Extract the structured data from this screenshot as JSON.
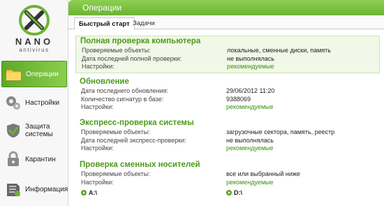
{
  "brand": {
    "name": "NANO",
    "sub": "antivirus"
  },
  "sidebar": {
    "items": [
      {
        "label": "Операции",
        "icon": "folder-scan-icon",
        "active": true
      },
      {
        "label": "Настройки",
        "icon": "gears-icon",
        "active": false
      },
      {
        "label": "Защита системы",
        "icon": "shield-check-icon",
        "active": false
      },
      {
        "label": "Карантин",
        "icon": "lock-icon",
        "active": false
      },
      {
        "label": "Информация",
        "icon": "info-book-icon",
        "active": false
      }
    ]
  },
  "header": {
    "title": "Операции"
  },
  "tabs": [
    {
      "label": "Быстрый старт",
      "active": true
    },
    {
      "label": "Задачи",
      "active": false
    }
  ],
  "sections": [
    {
      "title": "Полная проверка компьютера",
      "rows": [
        {
          "key": "Проверяемые объекты:",
          "value": "локальные, сменные диски, память"
        },
        {
          "key": "Дата последней полной проверки:",
          "value": "не выполнялась"
        },
        {
          "key": "Настройки:",
          "value": "рекомендуемые",
          "link": true
        }
      ]
    },
    {
      "title": "Обновление",
      "rows": [
        {
          "key": "Дата последнего обновления:",
          "value": "29/06/2012 11:20"
        },
        {
          "key": "Количество сигнатур в базе:",
          "value": "9388069"
        },
        {
          "key": "Настройки:",
          "value": "рекомендуемые",
          "link": true
        }
      ]
    },
    {
      "title": "Экспресс-проверка системы",
      "rows": [
        {
          "key": "Проверяемые объекты:",
          "value": "загрузочные сектора, память, реестр"
        },
        {
          "key": "Дата последней экспресс-проверки:",
          "value": "не выполнялась"
        },
        {
          "key": "Настройки:",
          "value": "рекомендуемые",
          "link": true
        }
      ]
    },
    {
      "title": "Проверка сменных носителей",
      "rows": [
        {
          "key": "Проверяемые объекты:",
          "value": "все или выбранный ниже"
        },
        {
          "key": "Настройки:",
          "value": "рекомендуемые",
          "link": true
        }
      ]
    }
  ],
  "drives": [
    "A:\\",
    "D:\\"
  ],
  "colors": {
    "accent": "#6db334",
    "link": "#3d8f12",
    "section_title": "#4c9a1a"
  }
}
